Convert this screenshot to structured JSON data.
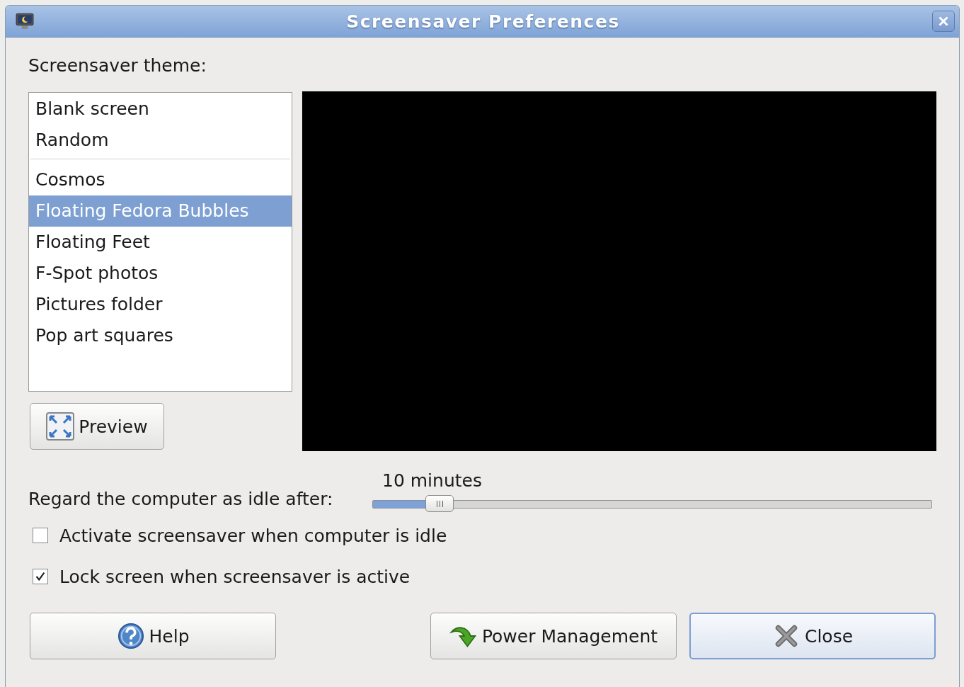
{
  "window": {
    "title": "Screensaver Preferences"
  },
  "theme_label": "Screensaver theme:",
  "theme_list": {
    "groups": [
      [
        {
          "label": "Blank screen",
          "selected": false
        },
        {
          "label": "Random",
          "selected": false
        }
      ],
      [
        {
          "label": "Cosmos",
          "selected": false
        },
        {
          "label": "Floating Fedora Bubbles",
          "selected": true
        },
        {
          "label": "Floating Feet",
          "selected": false
        },
        {
          "label": "F-Spot photos",
          "selected": false
        },
        {
          "label": "Pictures folder",
          "selected": false
        },
        {
          "label": "Pop art squares",
          "selected": false
        }
      ]
    ]
  },
  "preview_button": {
    "label": "Preview"
  },
  "idle": {
    "label": "Regard the computer as idle after:",
    "reading": "10 minutes",
    "level": 0.1
  },
  "checkboxes": [
    {
      "label": "Activate screensaver when computer is idle",
      "checked": false
    },
    {
      "label": "Lock screen when screensaver is active",
      "checked": true
    }
  ],
  "buttons": [
    {
      "kind": "help",
      "label": "Help",
      "default": false
    },
    {
      "kind": "power",
      "label": "Power Management",
      "default": false
    },
    {
      "kind": "close",
      "label": "Close",
      "default": true
    }
  ]
}
